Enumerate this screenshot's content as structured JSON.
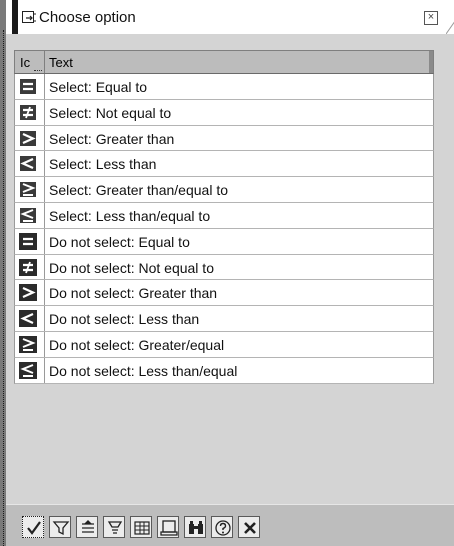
{
  "window": {
    "title": "Choose option",
    "close_label": "×"
  },
  "table": {
    "columns": [
      "Ic",
      "Text"
    ],
    "rows": [
      {
        "icon": "equal-icon",
        "variant": "include",
        "text": "Select: Equal to"
      },
      {
        "icon": "not-equal-icon",
        "variant": "include",
        "text": "Select: Not equal to"
      },
      {
        "icon": "greater-than-icon",
        "variant": "include",
        "text": "Select: Greater than"
      },
      {
        "icon": "less-than-icon",
        "variant": "include",
        "text": "Select: Less than"
      },
      {
        "icon": "greater-equal-icon",
        "variant": "include",
        "text": "Select: Greater than/equal to"
      },
      {
        "icon": "less-equal-icon",
        "variant": "include",
        "text": "Select: Less than/equal to"
      },
      {
        "icon": "equal-icon",
        "variant": "exclude",
        "text": "Do not select: Equal to"
      },
      {
        "icon": "not-equal-icon",
        "variant": "exclude",
        "text": "Do not select: Not equal to"
      },
      {
        "icon": "greater-than-icon",
        "variant": "exclude",
        "text": "Do not select: Greater than"
      },
      {
        "icon": "less-than-icon",
        "variant": "exclude",
        "text": "Do not select: Less than"
      },
      {
        "icon": "greater-equal-icon",
        "variant": "exclude",
        "text": "Do not select: Greater/equal"
      },
      {
        "icon": "less-equal-icon",
        "variant": "exclude",
        "text": "Do not select: Less than/equal"
      }
    ]
  },
  "toolbar": {
    "buttons": [
      {
        "name": "confirm-button",
        "icon": "checkmark-icon"
      },
      {
        "name": "filter-button",
        "icon": "filter-icon"
      },
      {
        "name": "sort-ascending-button",
        "icon": "sort-ascending-icon"
      },
      {
        "name": "sort-descending-button",
        "icon": "sort-descending-icon"
      },
      {
        "name": "table-view-button",
        "icon": "table-icon"
      },
      {
        "name": "print-button",
        "icon": "printer-icon"
      },
      {
        "name": "find-button",
        "icon": "binoculars-icon"
      },
      {
        "name": "help-button",
        "icon": "help-icon"
      },
      {
        "name": "cancel-button",
        "icon": "cancel-icon"
      }
    ]
  },
  "colors": {
    "dialog_bg": "#d4d4d4",
    "header_bg": "#bcbcbc",
    "icon_fill": "#2b2b2b",
    "toolbar_bg": "#bdbdbd"
  }
}
